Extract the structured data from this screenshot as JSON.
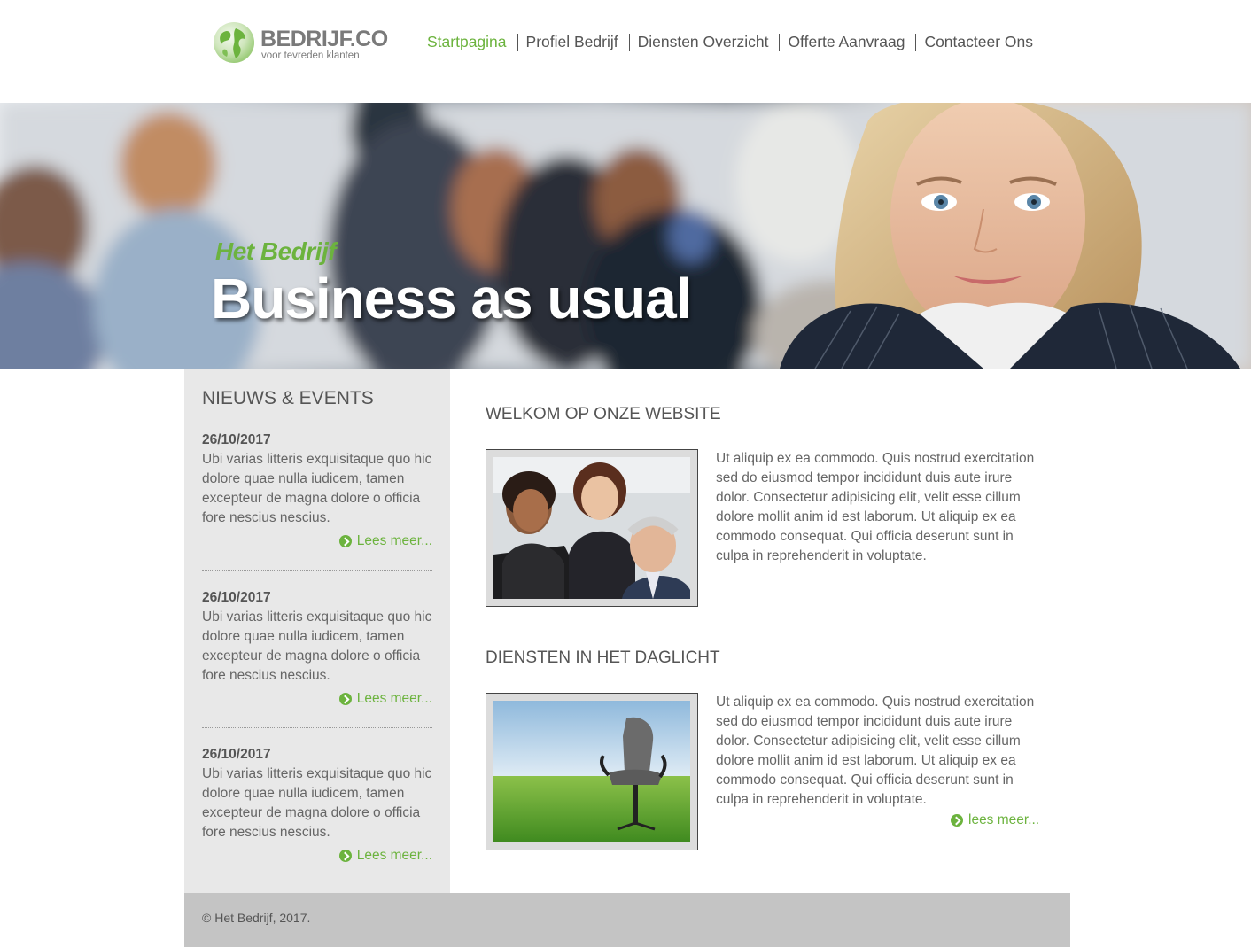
{
  "brand": {
    "name": "BEDRIJF",
    "suffix": ".CO",
    "tagline": "voor tevreden klanten"
  },
  "nav": {
    "items": [
      {
        "label": "Startpagina",
        "active": true
      },
      {
        "label": "Profiel Bedrijf",
        "active": false
      },
      {
        "label": "Diensten Overzicht",
        "active": false
      },
      {
        "label": "Offerte Aanvraag",
        "active": false
      },
      {
        "label": "Contacteer Ons",
        "active": false
      }
    ]
  },
  "hero": {
    "subtitle": "Het Bedrijf",
    "title": "Business as usual"
  },
  "sidebar": {
    "heading": "NIEUWS & EVENTS",
    "items": [
      {
        "date": "26/10/2017",
        "text": "Ubi varias litteris exquisitaque quo hic dolore quae nulla iudicem, tamen excepteur de magna dolore o officia fore nescius nescius.",
        "more": "Lees meer..."
      },
      {
        "date": "26/10/2017",
        "text": "Ubi varias litteris exquisitaque quo hic dolore quae nulla iudicem, tamen excepteur de magna dolore o officia fore nescius nescius.",
        "more": "Lees meer..."
      },
      {
        "date": "26/10/2017",
        "text": "Ubi varias litteris exquisitaque quo hic dolore quae nulla iudicem, tamen excepteur de magna dolore o officia fore nescius nescius.",
        "more": "Lees meer..."
      }
    ]
  },
  "main": {
    "welcome": {
      "heading": "WELKOM OP ONZE WEBSITE",
      "text": "Ut aliquip ex ea commodo. Quis nostrud exercitation sed do eiusmod tempor incididunt duis aute irure dolor. Consectetur adipisicing elit, velit esse cillum dolore mollit anim id est laborum. Ut aliquip ex ea commodo consequat. Qui officia deserunt sunt in culpa in reprehenderit in voluptate."
    },
    "services": {
      "heading": "DIENSTEN IN HET DAGLICHT",
      "text": "Ut aliquip ex ea commodo. Quis nostrud exercitation sed do eiusmod tempor incididunt duis aute irure dolor. Consectetur adipisicing elit, velit esse cillum dolore mollit anim id est laborum. Ut aliquip ex ea commodo consequat. Qui officia deserunt sunt in culpa in reprehenderit in voluptate.",
      "more": "lees meer..."
    }
  },
  "footer": {
    "copyright": "© Het Bedrijf, 2017."
  },
  "colors": {
    "accent": "#6cb33e",
    "sidebar_bg": "#e8e8e8",
    "footer_bg": "#c4c4c4",
    "text": "#555555"
  }
}
